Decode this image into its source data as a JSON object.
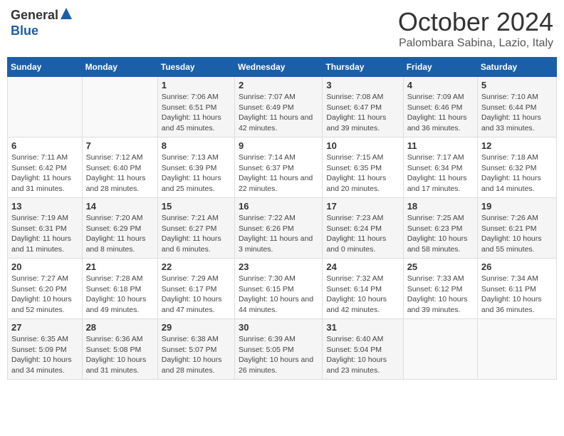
{
  "header": {
    "logo_general": "General",
    "logo_blue": "Blue",
    "month": "October 2024",
    "location": "Palombara Sabina, Lazio, Italy"
  },
  "days_of_week": [
    "Sunday",
    "Monday",
    "Tuesday",
    "Wednesday",
    "Thursday",
    "Friday",
    "Saturday"
  ],
  "weeks": [
    [
      {
        "day": "",
        "info": ""
      },
      {
        "day": "",
        "info": ""
      },
      {
        "day": "1",
        "info": "Sunrise: 7:06 AM\nSunset: 6:51 PM\nDaylight: 11 hours and 45 minutes."
      },
      {
        "day": "2",
        "info": "Sunrise: 7:07 AM\nSunset: 6:49 PM\nDaylight: 11 hours and 42 minutes."
      },
      {
        "day": "3",
        "info": "Sunrise: 7:08 AM\nSunset: 6:47 PM\nDaylight: 11 hours and 39 minutes."
      },
      {
        "day": "4",
        "info": "Sunrise: 7:09 AM\nSunset: 6:46 PM\nDaylight: 11 hours and 36 minutes."
      },
      {
        "day": "5",
        "info": "Sunrise: 7:10 AM\nSunset: 6:44 PM\nDaylight: 11 hours and 33 minutes."
      }
    ],
    [
      {
        "day": "6",
        "info": "Sunrise: 7:11 AM\nSunset: 6:42 PM\nDaylight: 11 hours and 31 minutes."
      },
      {
        "day": "7",
        "info": "Sunrise: 7:12 AM\nSunset: 6:40 PM\nDaylight: 11 hours and 28 minutes."
      },
      {
        "day": "8",
        "info": "Sunrise: 7:13 AM\nSunset: 6:39 PM\nDaylight: 11 hours and 25 minutes."
      },
      {
        "day": "9",
        "info": "Sunrise: 7:14 AM\nSunset: 6:37 PM\nDaylight: 11 hours and 22 minutes."
      },
      {
        "day": "10",
        "info": "Sunrise: 7:15 AM\nSunset: 6:35 PM\nDaylight: 11 hours and 20 minutes."
      },
      {
        "day": "11",
        "info": "Sunrise: 7:17 AM\nSunset: 6:34 PM\nDaylight: 11 hours and 17 minutes."
      },
      {
        "day": "12",
        "info": "Sunrise: 7:18 AM\nSunset: 6:32 PM\nDaylight: 11 hours and 14 minutes."
      }
    ],
    [
      {
        "day": "13",
        "info": "Sunrise: 7:19 AM\nSunset: 6:31 PM\nDaylight: 11 hours and 11 minutes."
      },
      {
        "day": "14",
        "info": "Sunrise: 7:20 AM\nSunset: 6:29 PM\nDaylight: 11 hours and 8 minutes."
      },
      {
        "day": "15",
        "info": "Sunrise: 7:21 AM\nSunset: 6:27 PM\nDaylight: 11 hours and 6 minutes."
      },
      {
        "day": "16",
        "info": "Sunrise: 7:22 AM\nSunset: 6:26 PM\nDaylight: 11 hours and 3 minutes."
      },
      {
        "day": "17",
        "info": "Sunrise: 7:23 AM\nSunset: 6:24 PM\nDaylight: 11 hours and 0 minutes."
      },
      {
        "day": "18",
        "info": "Sunrise: 7:25 AM\nSunset: 6:23 PM\nDaylight: 10 hours and 58 minutes."
      },
      {
        "day": "19",
        "info": "Sunrise: 7:26 AM\nSunset: 6:21 PM\nDaylight: 10 hours and 55 minutes."
      }
    ],
    [
      {
        "day": "20",
        "info": "Sunrise: 7:27 AM\nSunset: 6:20 PM\nDaylight: 10 hours and 52 minutes."
      },
      {
        "day": "21",
        "info": "Sunrise: 7:28 AM\nSunset: 6:18 PM\nDaylight: 10 hours and 49 minutes."
      },
      {
        "day": "22",
        "info": "Sunrise: 7:29 AM\nSunset: 6:17 PM\nDaylight: 10 hours and 47 minutes."
      },
      {
        "day": "23",
        "info": "Sunrise: 7:30 AM\nSunset: 6:15 PM\nDaylight: 10 hours and 44 minutes."
      },
      {
        "day": "24",
        "info": "Sunrise: 7:32 AM\nSunset: 6:14 PM\nDaylight: 10 hours and 42 minutes."
      },
      {
        "day": "25",
        "info": "Sunrise: 7:33 AM\nSunset: 6:12 PM\nDaylight: 10 hours and 39 minutes."
      },
      {
        "day": "26",
        "info": "Sunrise: 7:34 AM\nSunset: 6:11 PM\nDaylight: 10 hours and 36 minutes."
      }
    ],
    [
      {
        "day": "27",
        "info": "Sunrise: 6:35 AM\nSunset: 5:09 PM\nDaylight: 10 hours and 34 minutes."
      },
      {
        "day": "28",
        "info": "Sunrise: 6:36 AM\nSunset: 5:08 PM\nDaylight: 10 hours and 31 minutes."
      },
      {
        "day": "29",
        "info": "Sunrise: 6:38 AM\nSunset: 5:07 PM\nDaylight: 10 hours and 28 minutes."
      },
      {
        "day": "30",
        "info": "Sunrise: 6:39 AM\nSunset: 5:05 PM\nDaylight: 10 hours and 26 minutes."
      },
      {
        "day": "31",
        "info": "Sunrise: 6:40 AM\nSunset: 5:04 PM\nDaylight: 10 hours and 23 minutes."
      },
      {
        "day": "",
        "info": ""
      },
      {
        "day": "",
        "info": ""
      }
    ]
  ]
}
